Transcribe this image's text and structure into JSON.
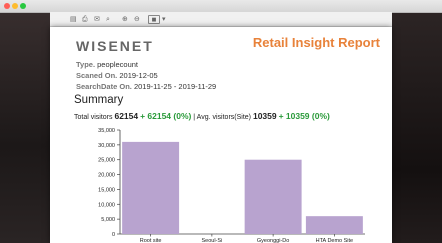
{
  "window": {
    "traffic_light_colors": [
      "#ff5f57",
      "#febc2e",
      "#28c840"
    ]
  },
  "toolbar": {
    "icons": [
      "sidebar-icon",
      "print-icon",
      "mail-icon",
      "search-icon",
      "zoom-in-icon",
      "zoom-out-icon",
      "view-mode-icon"
    ],
    "page_indicator": "▾"
  },
  "report": {
    "logo": "WISENET",
    "title": "Retail Insight Report",
    "accent_color": "#e8823a",
    "type_label": "Type.",
    "type_value": "peoplecount",
    "scanned_label": "Scaned On.",
    "scanned_value": "2019-12-05",
    "search_label": "SearchDate On.",
    "search_value": "2019-11-25 - 2019-11-29",
    "summary_heading": "Summary",
    "total_label": "Total visitors",
    "total_value": "62154",
    "total_change": "+ 62154 (0%)",
    "avg_label": "| Avg. visitors(Site)",
    "avg_value": "10359",
    "avg_change": "+ 10359 (0%)"
  },
  "chart_data": {
    "type": "bar",
    "categories": [
      "Root site",
      "Seoul-Si",
      "Gyeonggi-Do",
      "HTA Demo Site"
    ],
    "values": [
      31000,
      0,
      25000,
      6000
    ],
    "ylim": [
      0,
      35000
    ],
    "yticks": [
      "0",
      "5,000",
      "10,000",
      "15,000",
      "20,000",
      "25,000",
      "30,000",
      "35,000"
    ],
    "bar_color": "#b8a3cf",
    "grid": false
  }
}
